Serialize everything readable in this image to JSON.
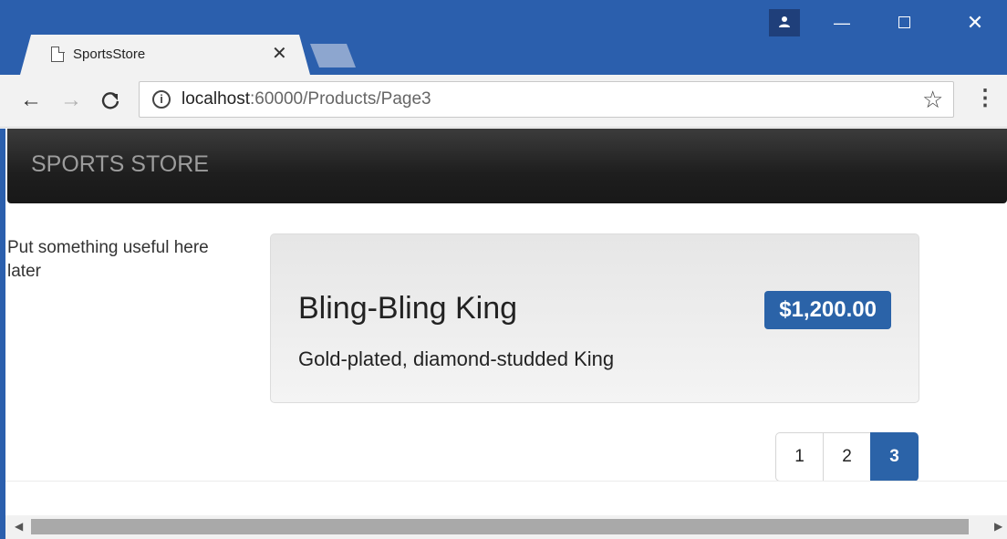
{
  "browser": {
    "tab_title": "SportsStore",
    "tab_close": "✕",
    "profile_icon": "person-icon",
    "window_min": "—",
    "window_close": "✕",
    "nav_back": "←",
    "nav_forward": "→",
    "nav_reload": "C",
    "info_glyph": "i",
    "url_host": "localhost",
    "url_path": ":60000/Products/Page3",
    "star": "☆",
    "menu": "⋮"
  },
  "site": {
    "brand": "SPORTS STORE",
    "sidebar_text": "Put something useful here later"
  },
  "product": {
    "name": "Bling-Bling King",
    "price": "$1,200.00",
    "description": "Gold-plated, diamond-studded King"
  },
  "pagination": {
    "pages": [
      "1",
      "2",
      "3"
    ],
    "current": "3"
  },
  "scrollbar": {
    "left_arrow": "◀",
    "right_arrow": "▶"
  },
  "colors": {
    "chrome_frame": "#2b5fad",
    "navbar": "#222222",
    "accent": "#2b63a8"
  }
}
